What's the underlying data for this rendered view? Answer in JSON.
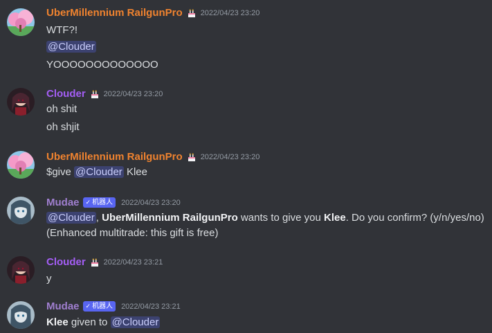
{
  "messages": [
    {
      "author": "UberMillennium RailgunPro",
      "timestamp": "2022/04/23 23:20",
      "lines": [
        "WTF?!",
        "@Clouder",
        "YOOOOOOOOOOOOO"
      ]
    },
    {
      "author": "Clouder",
      "timestamp": "2022/04/23 23:20",
      "lines": [
        "oh shit",
        "oh shjit"
      ]
    },
    {
      "author": "UberMillennium RailgunPro",
      "timestamp": "2022/04/23 23:20",
      "line_prefix": "$give ",
      "mention": "@Clouder",
      "line_suffix": " Klee"
    },
    {
      "author": "Mudae",
      "bot_label": "机器人",
      "timestamp": "2022/04/23 23:20",
      "mention": "@Clouder",
      "sep": ", ",
      "giver": "UberMillennium RailgunPro",
      "mid": " wants to give you ",
      "item": "Klee",
      "end": ". Do you confirm? (y/n/yes/no)",
      "line2": "(Enhanced multitrade: this gift is free)"
    },
    {
      "author": "Clouder",
      "timestamp": "2022/04/23 23:21",
      "lines": [
        "y"
      ]
    },
    {
      "author": "Mudae",
      "bot_label": "机器人",
      "timestamp": "2022/04/23 23:21",
      "item": "Klee",
      "mid": " given to ",
      "mention": "@Clouder"
    }
  ],
  "colors": {
    "background": "#313338",
    "orange_name": "#f0832f",
    "purple_name": "#a45ef5",
    "mudae_name": "#a07fd0",
    "bot_badge": "#5865f2",
    "mention_bg": "#3c4270"
  }
}
